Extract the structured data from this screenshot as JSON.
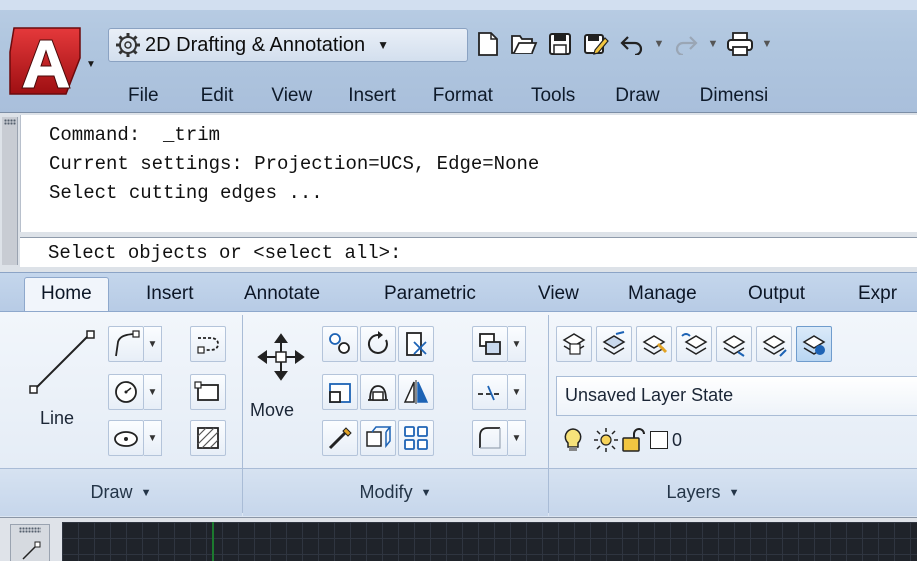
{
  "quick_access": {
    "workspace": "2D Drafting & Annotation",
    "buttons": [
      "new-icon",
      "open-icon",
      "save-icon",
      "save-as-icon",
      "undo-icon",
      "redo-icon",
      "plot-icon"
    ]
  },
  "menu": [
    "File",
    "Edit",
    "View",
    "Insert",
    "Format",
    "Tools",
    "Draw",
    "Dimensi"
  ],
  "command": {
    "history": [
      "Command:  _trim",
      "Current settings: Projection=UCS, Edge=None",
      "Select cutting edges ..."
    ],
    "prompt": "Select objects or <select all>:"
  },
  "ribbon": {
    "tabs": [
      "Home",
      "Insert",
      "Annotate",
      "Parametric",
      "View",
      "Manage",
      "Output",
      "Expr"
    ],
    "active_tab": "Home",
    "panels": {
      "draw": {
        "title": "Draw",
        "big_tool": "Line"
      },
      "modify": {
        "title": "Modify",
        "big_tool": "Move"
      },
      "layers": {
        "title": "Layers",
        "layer_state": "Unsaved Layer State",
        "current_layer": "0"
      }
    }
  },
  "colors": {
    "accent": "#b0c6df",
    "canvas": "#1f232a",
    "autocad_red": "#c3171b"
  }
}
